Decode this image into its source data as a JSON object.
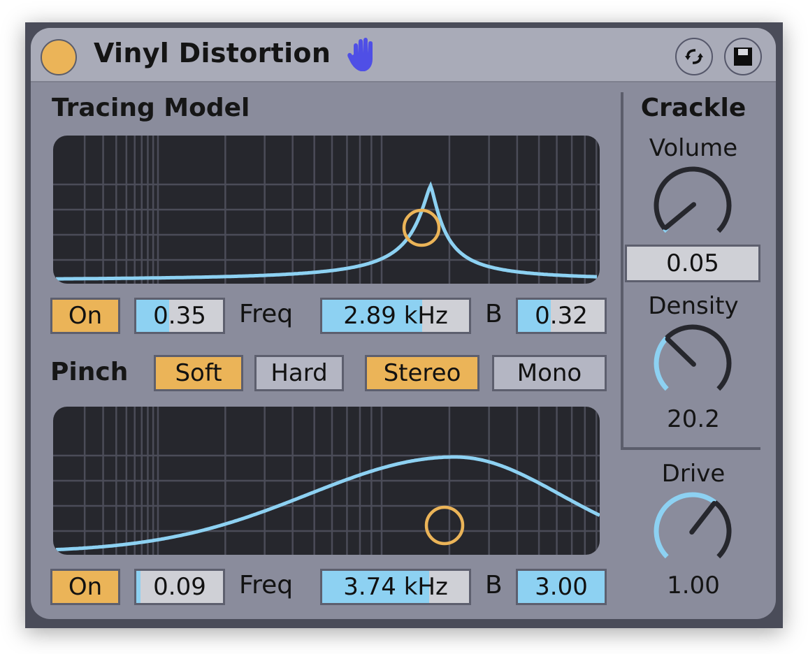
{
  "device": {
    "title": "Vinyl Distortion",
    "power_on": true,
    "colors": {
      "accent_orange": "#ebb458",
      "accent_blue": "#8dd1f2",
      "hand_icon": "#4f4fe6",
      "graph_bg": "#26272d",
      "panel_bg": "#8a8c9c"
    },
    "icons": {
      "power": "power-button",
      "hand": "hand-icon",
      "refresh": "refresh-arrows-icon",
      "save": "floppy-save-icon"
    }
  },
  "tracing": {
    "title": "Tracing Model",
    "on_label": "On",
    "drive_value": "0.35",
    "drive_fill": 0.38,
    "freq_label": "Freq",
    "freq_value": "2.89 kHz",
    "freq_fill": 0.68,
    "b_label": "B",
    "b_value": "0.32",
    "b_fill": 0.38
  },
  "pinch": {
    "label": "Pinch",
    "soft_label": "Soft",
    "hard_label": "Hard",
    "soft_selected": true,
    "stereo_label": "Stereo",
    "mono_label": "Mono",
    "stereo_selected": true,
    "on_label": "On",
    "drive_value": "0.09",
    "drive_fill": 0.05,
    "freq_label": "Freq",
    "freq_value": "3.74 kHz",
    "freq_fill": 0.73,
    "b_label": "B",
    "b_value": "3.00",
    "b_fill": 1.0
  },
  "crackle": {
    "title": "Crackle",
    "volume_label": "Volume",
    "volume_value": "0.05",
    "volume_fraction": 0.02,
    "density_label": "Density",
    "density_value": "20.2",
    "density_fraction": 0.33
  },
  "drive": {
    "label": "Drive",
    "value": "1.00",
    "fraction": 0.64
  }
}
